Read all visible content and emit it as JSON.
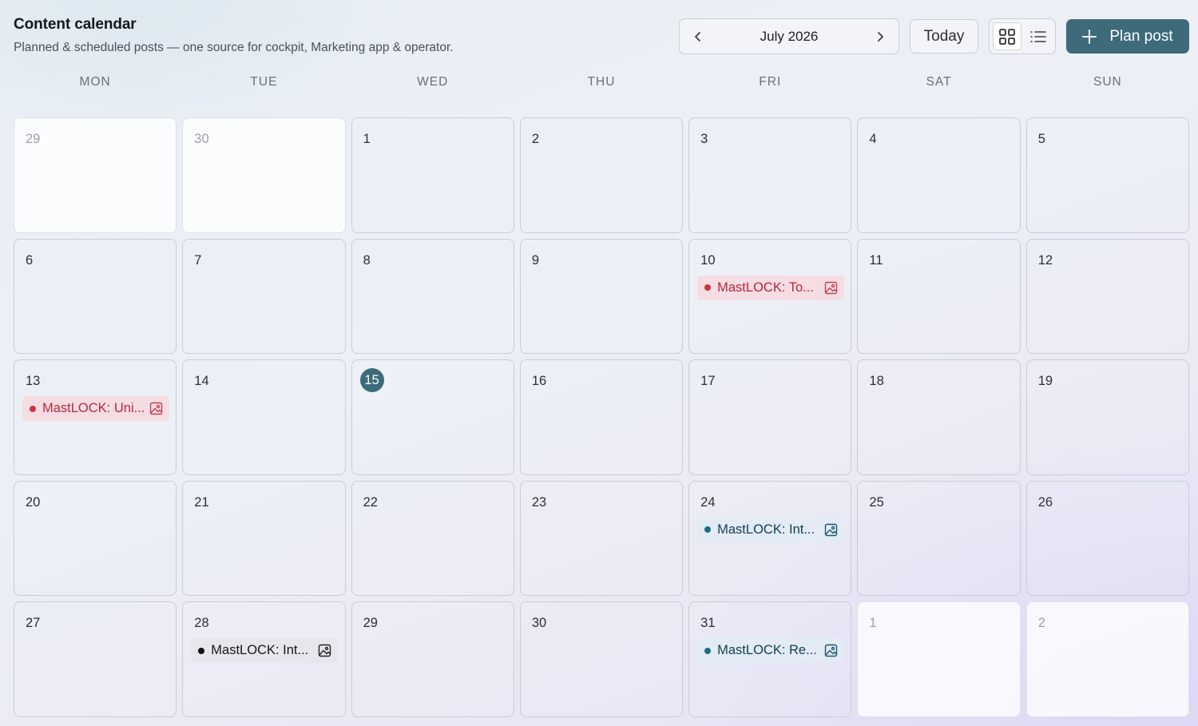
{
  "header": {
    "title": "Content calendar",
    "subtitle": "Planned & scheduled posts — one source for cockpit, Marketing app & operator."
  },
  "toolbar": {
    "month_label": "July 2026",
    "today_label": "Today",
    "plan_label": "Plan post",
    "active_view": "grid",
    "accent_color": "#3d6b79"
  },
  "weekdays": [
    "MON",
    "TUE",
    "WED",
    "THU",
    "FRI",
    "SAT",
    "SUN"
  ],
  "weeks": [
    [
      {
        "day": "29",
        "out": true
      },
      {
        "day": "30",
        "out": true
      },
      {
        "day": "1"
      },
      {
        "day": "2"
      },
      {
        "day": "3"
      },
      {
        "day": "4"
      },
      {
        "day": "5"
      }
    ],
    [
      {
        "day": "6"
      },
      {
        "day": "7"
      },
      {
        "day": "8"
      },
      {
        "day": "9"
      },
      {
        "day": "10",
        "event": {
          "title": "MastLOCK: To...",
          "status": "red",
          "icon": "image-icon"
        }
      },
      {
        "day": "11"
      },
      {
        "day": "12"
      }
    ],
    [
      {
        "day": "13",
        "event": {
          "title": "MastLOCK: Uni...",
          "status": "red",
          "icon": "image-icon"
        }
      },
      {
        "day": "14"
      },
      {
        "day": "15",
        "today": true
      },
      {
        "day": "16"
      },
      {
        "day": "17"
      },
      {
        "day": "18"
      },
      {
        "day": "19"
      }
    ],
    [
      {
        "day": "20"
      },
      {
        "day": "21"
      },
      {
        "day": "22"
      },
      {
        "day": "23"
      },
      {
        "day": "24",
        "event": {
          "title": "MastLOCK: Int...",
          "status": "blue",
          "icon": "image-icon"
        }
      },
      {
        "day": "25"
      },
      {
        "day": "26"
      }
    ],
    [
      {
        "day": "27"
      },
      {
        "day": "28",
        "event": {
          "title": "MastLOCK: Int...",
          "status": "black",
          "icon": "image-icon"
        }
      },
      {
        "day": "29"
      },
      {
        "day": "30"
      },
      {
        "day": "31",
        "event": {
          "title": "MastLOCK: Re...",
          "status": "blue",
          "icon": "image-icon"
        }
      },
      {
        "day": "1",
        "out": true
      },
      {
        "day": "2",
        "out": true
      }
    ]
  ]
}
